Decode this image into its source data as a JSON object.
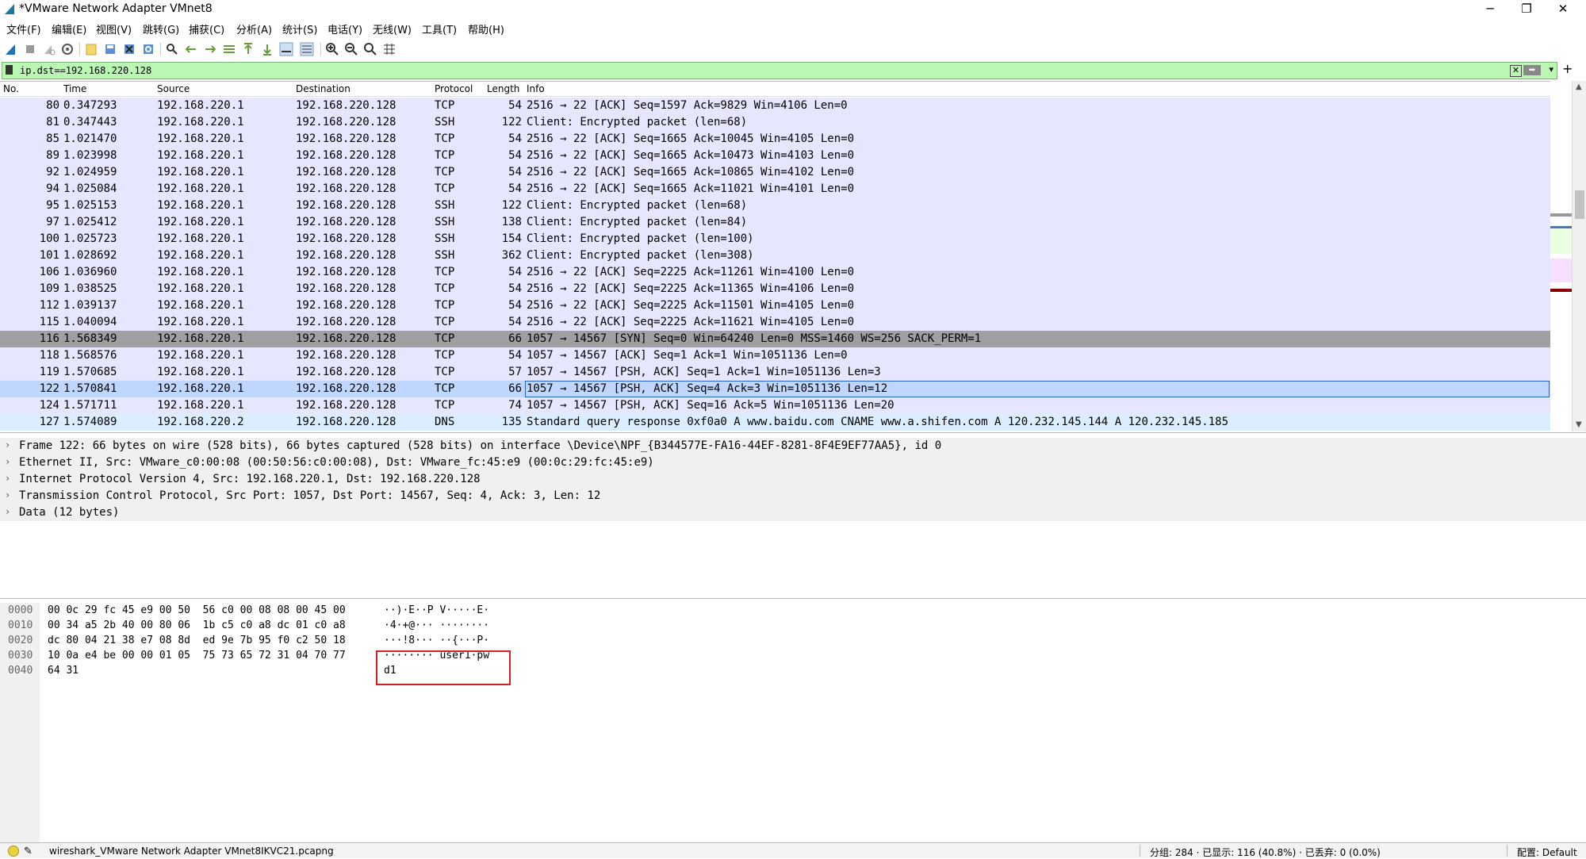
{
  "window": {
    "title": "*VMware Network Adapter VMnet8",
    "minimize": "─",
    "restore": "❐",
    "close": "✕"
  },
  "menu": [
    "文件(F)",
    "编辑(E)",
    "视图(V)",
    "跳转(G)",
    "捕获(C)",
    "分析(A)",
    "统计(S)",
    "电话(Y)",
    "无线(W)",
    "工具(T)",
    "帮助(H)"
  ],
  "toolbar": {
    "icons": [
      "shark-fin-start-icon",
      "stop-square-icon",
      "restart-icon",
      "capture-options-gear-icon",
      "open-folder-icon",
      "save-file-icon",
      "close-file-icon",
      "reload-file-icon",
      "find-packet-icon",
      "go-back-arrow-icon",
      "go-forward-arrow-icon",
      "go-to-packet-icon",
      "go-first-packet-icon",
      "go-last-packet-icon",
      "auto-scroll-icon",
      "colorize-icon",
      "zoom-in-icon",
      "zoom-out-icon",
      "normal-size-icon",
      "resize-columns-icon"
    ]
  },
  "filter": {
    "value": "ip.dst==192.168.220.128",
    "clear_glyph": "✕",
    "apply_glyph": "➡",
    "dropdown_glyph": "▾",
    "add_glyph": "+"
  },
  "packet_list": {
    "columns": [
      "No.",
      "Time",
      "Source",
      "Destination",
      "Protocol",
      "Length",
      "Info"
    ],
    "rows": [
      {
        "no": "80",
        "time": "0.347293",
        "src": "192.168.220.1",
        "dst": "192.168.220.128",
        "proto": "TCP",
        "len": "54",
        "info": "2516 → 22 [ACK] Seq=1597 Ack=9829 Win=4106 Len=0",
        "kind": "tcp"
      },
      {
        "no": "81",
        "time": "0.347443",
        "src": "192.168.220.1",
        "dst": "192.168.220.128",
        "proto": "SSH",
        "len": "122",
        "info": "Client: Encrypted packet (len=68)",
        "kind": "tcp"
      },
      {
        "no": "85",
        "time": "1.021470",
        "src": "192.168.220.1",
        "dst": "192.168.220.128",
        "proto": "TCP",
        "len": "54",
        "info": "2516 → 22 [ACK] Seq=1665 Ack=10045 Win=4105 Len=0",
        "kind": "tcp"
      },
      {
        "no": "89",
        "time": "1.023998",
        "src": "192.168.220.1",
        "dst": "192.168.220.128",
        "proto": "TCP",
        "len": "54",
        "info": "2516 → 22 [ACK] Seq=1665 Ack=10473 Win=4103 Len=0",
        "kind": "tcp"
      },
      {
        "no": "92",
        "time": "1.024959",
        "src": "192.168.220.1",
        "dst": "192.168.220.128",
        "proto": "TCP",
        "len": "54",
        "info": "2516 → 22 [ACK] Seq=1665 Ack=10865 Win=4102 Len=0",
        "kind": "tcp"
      },
      {
        "no": "94",
        "time": "1.025084",
        "src": "192.168.220.1",
        "dst": "192.168.220.128",
        "proto": "TCP",
        "len": "54",
        "info": "2516 → 22 [ACK] Seq=1665 Ack=11021 Win=4101 Len=0",
        "kind": "tcp"
      },
      {
        "no": "95",
        "time": "1.025153",
        "src": "192.168.220.1",
        "dst": "192.168.220.128",
        "proto": "SSH",
        "len": "122",
        "info": "Client: Encrypted packet (len=68)",
        "kind": "tcp"
      },
      {
        "no": "97",
        "time": "1.025412",
        "src": "192.168.220.1",
        "dst": "192.168.220.128",
        "proto": "SSH",
        "len": "138",
        "info": "Client: Encrypted packet (len=84)",
        "kind": "tcp"
      },
      {
        "no": "100",
        "time": "1.025723",
        "src": "192.168.220.1",
        "dst": "192.168.220.128",
        "proto": "SSH",
        "len": "154",
        "info": "Client: Encrypted packet (len=100)",
        "kind": "tcp"
      },
      {
        "no": "101",
        "time": "1.028692",
        "src": "192.168.220.1",
        "dst": "192.168.220.128",
        "proto": "SSH",
        "len": "362",
        "info": "Client: Encrypted packet (len=308)",
        "kind": "tcp"
      },
      {
        "no": "106",
        "time": "1.036960",
        "src": "192.168.220.1",
        "dst": "192.168.220.128",
        "proto": "TCP",
        "len": "54",
        "info": "2516 → 22 [ACK] Seq=2225 Ack=11261 Win=4100 Len=0",
        "kind": "tcp"
      },
      {
        "no": "109",
        "time": "1.038525",
        "src": "192.168.220.1",
        "dst": "192.168.220.128",
        "proto": "TCP",
        "len": "54",
        "info": "2516 → 22 [ACK] Seq=2225 Ack=11365 Win=4106 Len=0",
        "kind": "tcp"
      },
      {
        "no": "112",
        "time": "1.039137",
        "src": "192.168.220.1",
        "dst": "192.168.220.128",
        "proto": "TCP",
        "len": "54",
        "info": "2516 → 22 [ACK] Seq=2225 Ack=11501 Win=4105 Len=0",
        "kind": "tcp"
      },
      {
        "no": "115",
        "time": "1.040094",
        "src": "192.168.220.1",
        "dst": "192.168.220.128",
        "proto": "TCP",
        "len": "54",
        "info": "2516 → 22 [ACK] Seq=2225 Ack=11621 Win=4105 Len=0",
        "kind": "tcp"
      },
      {
        "no": "116",
        "time": "1.568349",
        "src": "192.168.220.1",
        "dst": "192.168.220.128",
        "proto": "TCP",
        "len": "66",
        "info": "1057 → 14567 [SYN] Seq=0 Win=64240 Len=0 MSS=1460 WS=256 SACK_PERM=1",
        "kind": "syn"
      },
      {
        "no": "118",
        "time": "1.568576",
        "src": "192.168.220.1",
        "dst": "192.168.220.128",
        "proto": "TCP",
        "len": "54",
        "info": "1057 → 14567 [ACK] Seq=1 Ack=1 Win=1051136 Len=0",
        "kind": "tcp"
      },
      {
        "no": "119",
        "time": "1.570685",
        "src": "192.168.220.1",
        "dst": "192.168.220.128",
        "proto": "TCP",
        "len": "57",
        "info": "1057 → 14567 [PSH, ACK] Seq=1 Ack=1 Win=1051136 Len=3",
        "kind": "tcp"
      },
      {
        "no": "122",
        "time": "1.570841",
        "src": "192.168.220.1",
        "dst": "192.168.220.128",
        "proto": "TCP",
        "len": "66",
        "info": "1057 → 14567 [PSH, ACK] Seq=4 Ack=3 Win=1051136 Len=12",
        "kind": "sel"
      },
      {
        "no": "124",
        "time": "1.571711",
        "src": "192.168.220.1",
        "dst": "192.168.220.128",
        "proto": "TCP",
        "len": "74",
        "info": "1057 → 14567 [PSH, ACK] Seq=16 Ack=5 Win=1051136 Len=20",
        "kind": "tcp"
      },
      {
        "no": "127",
        "time": "1.574089",
        "src": "192.168.220.2",
        "dst": "192.168.220.128",
        "proto": "DNS",
        "len": "135",
        "info": "Standard query response 0xf0a0 A www.baidu.com CNAME www.a.shifen.com A 120.232.145.144 A 120.232.145.185",
        "kind": "dns"
      }
    ]
  },
  "details": [
    "Frame 122: 66 bytes on wire (528 bits), 66 bytes captured (528 bits) on interface \\Device\\NPF_{B344577E-FA16-44EF-8281-8F4E9EF77AA5}, id 0",
    "Ethernet II, Src: VMware_c0:00:08 (00:50:56:c0:00:08), Dst: VMware_fc:45:e9 (00:0c:29:fc:45:e9)",
    "Internet Protocol Version 4, Src: 192.168.220.1, Dst: 192.168.220.128",
    "Transmission Control Protocol, Src Port: 1057, Dst Port: 14567, Seq: 4, Ack: 3, Len: 12",
    "Data (12 bytes)"
  ],
  "bytes": [
    {
      "offset": "0000",
      "hex": "00 0c 29 fc 45 e9 00 50  56 c0 00 08 08 00 45 00",
      "ascii": "··)·E··P V·····E·"
    },
    {
      "offset": "0010",
      "hex": "00 34 a5 2b 40 00 80 06  1b c5 c0 a8 dc 01 c0 a8",
      "ascii": "·4·+@··· ········"
    },
    {
      "offset": "0020",
      "hex": "dc 80 04 21 38 e7 08 8d  ed 9e 7b 95 f0 c2 50 18",
      "ascii": "···!8··· ··{···P·"
    },
    {
      "offset": "0030",
      "hex": "10 0a e4 be 00 00 01 05  75 73 65 72 31 04 70 77",
      "ascii": "········ user1·pw"
    },
    {
      "offset": "0040",
      "hex": "64 31",
      "ascii": "d1"
    }
  ],
  "status": {
    "file": "wireshark_VMware Network Adapter VMnet8IKVC21.pcapng",
    "counts": "分组: 284 · 已显示: 116 (40.8%) · 已丢弃: 0 (0.0%)",
    "profile": "配置: Default"
  },
  "colors": {
    "filter_ok": "#b9f7b3",
    "row_tcp": "#e7e6ff",
    "row_dns": "#daeeff",
    "row_syn": "#a0a0a0",
    "row_selected": "#bfd6ff",
    "highlight_box": "#d71f26"
  }
}
